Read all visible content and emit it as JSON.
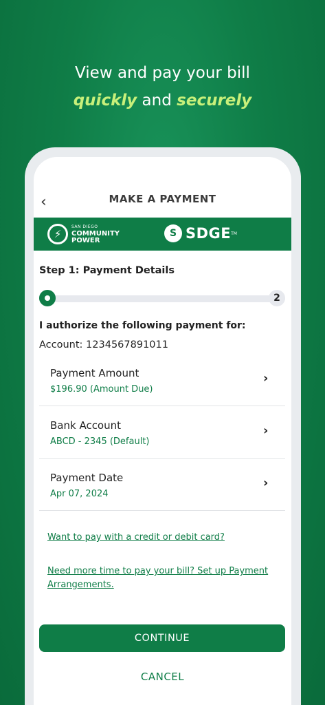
{
  "headline": {
    "line1": "View and pay your bill",
    "highlight1": "quickly",
    "connector": " and ",
    "highlight2": "securely"
  },
  "nav": {
    "back_icon": "chevron-left-icon",
    "title": "MAKE A PAYMENT"
  },
  "brands": {
    "community_power_small": "SAN DIEGO",
    "community_power_line1": "COMMUNITY",
    "community_power_line2": "POWER",
    "sdge": "SDGE",
    "sdge_tm": "TM"
  },
  "step": {
    "title": "Step 1: Payment Details",
    "progress_fraction": 0.0,
    "total_steps": "2"
  },
  "authorize": "I authorize the following payment for:",
  "account": "Account: 1234567891011",
  "rows": [
    {
      "label": "Payment Amount",
      "value": "$196.90 (Amount Due)"
    },
    {
      "label": "Bank Account",
      "value": "ABCD - 2345 (Default)"
    },
    {
      "label": "Payment Date",
      "value": "Apr 07, 2024"
    }
  ],
  "links": {
    "credit_card": "Want to pay with a credit or debit card?",
    "arrangements_line1": "Need more time to pay your bill? Set up Payment",
    "arrangements_line2": "Arrangements."
  },
  "buttons": {
    "continue": "CONTINUE",
    "cancel": "CANCEL"
  },
  "colors": {
    "brand_green": "#0f7d47",
    "highlight": "#c8f07a"
  }
}
